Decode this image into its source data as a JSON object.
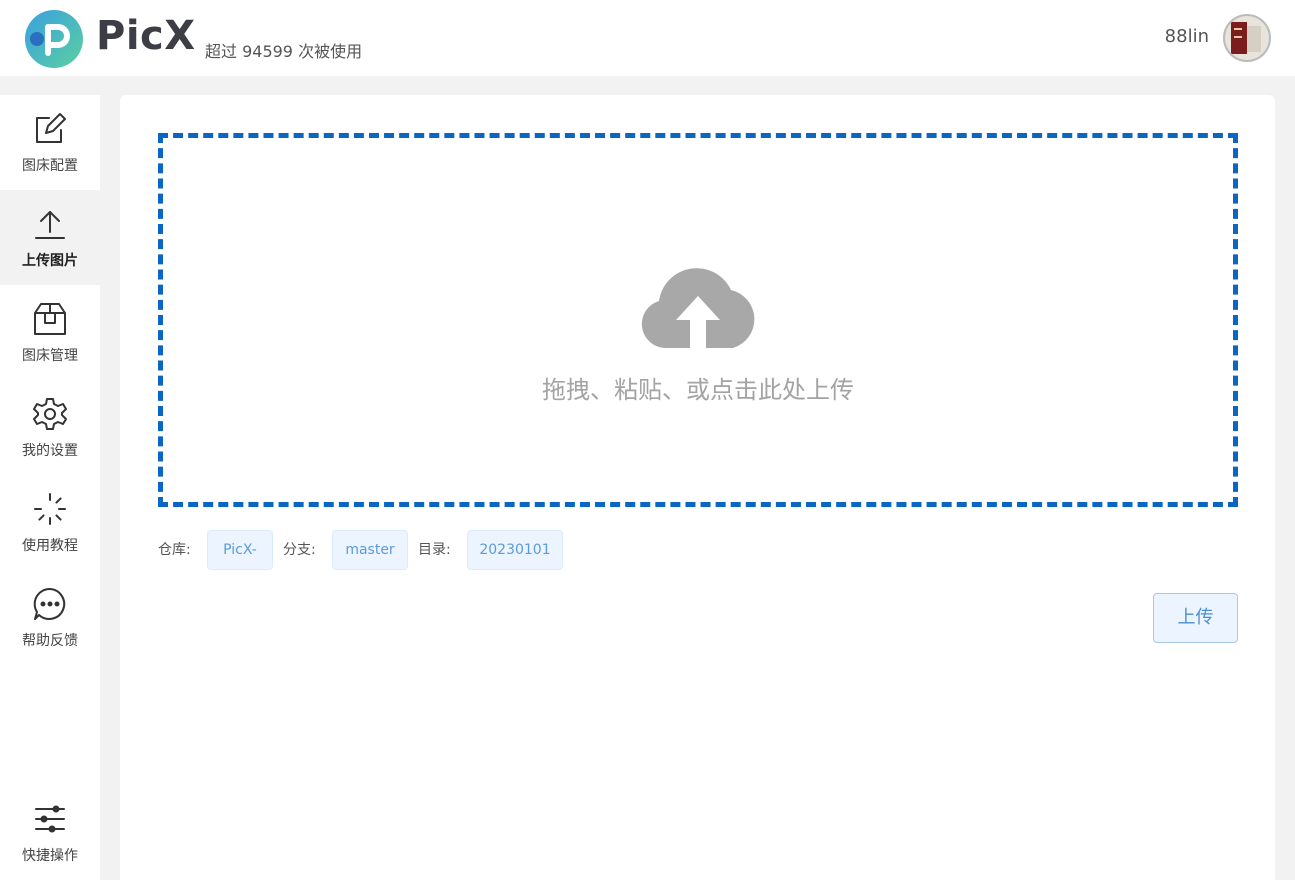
{
  "header": {
    "brand": "PicX",
    "usage": "超过 94599 次被使用",
    "username": "88lin"
  },
  "sidebar": {
    "items": [
      {
        "label": "图床配置",
        "icon": "edit-icon"
      },
      {
        "label": "上传图片",
        "icon": "upload-icon",
        "active": true
      },
      {
        "label": "图床管理",
        "icon": "box-icon"
      },
      {
        "label": "我的设置",
        "icon": "gear-icon"
      },
      {
        "label": "使用教程",
        "icon": "loading-icon"
      },
      {
        "label": "帮助反馈",
        "icon": "chat-icon"
      },
      {
        "label": "快捷操作",
        "icon": "sliders-icon"
      }
    ]
  },
  "upload": {
    "drop_text": "拖拽、粘贴、或点击此处上传",
    "repo_label": "仓库:",
    "repo_value": "PicX-",
    "branch_label": "分支:",
    "branch_value": "master",
    "dir_label": "目录:",
    "dir_value": "20230101",
    "upload_button": "上传"
  },
  "colors": {
    "accent": "#0a66c2",
    "tag_bg": "#ecf5ff",
    "tag_text": "#5a9bd8"
  }
}
